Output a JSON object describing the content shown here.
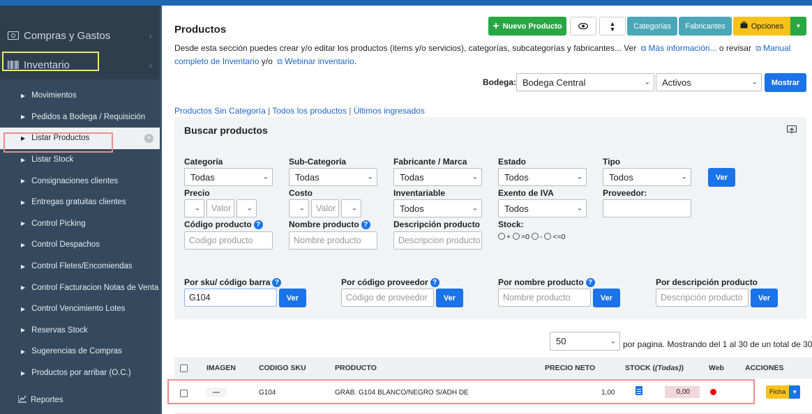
{
  "sidebar": {
    "sections": [
      {
        "label": "Compras y Gastos",
        "icon": "money-icon"
      },
      {
        "label": "Inventario",
        "icon": "barcode-icon"
      }
    ],
    "items": [
      {
        "label": "Movimientos"
      },
      {
        "label": "Pedidos a Bodega / Requisición"
      },
      {
        "label": "Listar Productos"
      },
      {
        "label": "Listar Stock"
      },
      {
        "label": "Consignaciones clientes"
      },
      {
        "label": "Entregas gratuitas clientes"
      },
      {
        "label": "Control Picking"
      },
      {
        "label": "Control Despachos"
      },
      {
        "label": "Control Fletes/Encomiendas"
      },
      {
        "label": "Control Facturacion Notas de Venta"
      },
      {
        "label": "Control Vencimiento Lotes"
      },
      {
        "label": "Reservas Stock"
      },
      {
        "label": "Sugerencias de Compras"
      },
      {
        "label": "Productos por arribar (O.C.)"
      }
    ],
    "reportes": "Reportes"
  },
  "header": {
    "title": "Productos",
    "nuevo_producto": "Nuevo Producto",
    "categorias": "Categorías",
    "fabricantes": "Fabricantes",
    "opciones": "Opciones"
  },
  "description": {
    "text1": "Desde esta sección puedes crear y/o editar los productos (items y/o servicios), categorías, subcategorías y fabricantes... Ver",
    "link1": "Más información...",
    "text2": "o revisar",
    "link2": "Manual completo de Inventario",
    "text3": "y/o",
    "link3": "Webinar inventario",
    "text4": "."
  },
  "filters_top": {
    "bodega_label": "Bodega:",
    "bodega_value": "Bodega Central",
    "estado_value": "Activos",
    "mostrar": "Mostrar"
  },
  "quick_links": [
    "Productos Sin Categoría",
    "Todos los productos",
    "Últimos ingresados"
  ],
  "search": {
    "title": "Buscar productos",
    "categoria_label": "Categoría",
    "categoria_value": "Todas",
    "subcategoria_label": "Sub-Categoría",
    "subcategoria_value": "Todas",
    "fabricante_label": "Fabricante / Marca",
    "fabricante_value": "Todas",
    "estado_label": "Estado",
    "estado_value": "Todos",
    "tipo_label": "Tipo",
    "tipo_value": "Todos",
    "ver": "Ver",
    "precio_label": "Precio",
    "precio_placeholder": "Valor",
    "costo_label": "Costo",
    "costo_placeholder": "Valor",
    "inventariable_label": "Inventariable",
    "inventariable_value": "Todos",
    "exento_label": "Exento de IVA",
    "exento_value": "Todos",
    "proveedor_label": "Proveedor:",
    "codigo_label": "Código producto",
    "codigo_placeholder": "Codigo producto",
    "nombre_label": "Nombre producto",
    "nombre_placeholder": "Nombre producto",
    "descripcion_label": "Descripción producto",
    "descripcion_placeholder": "Descripcion producto",
    "stock_label": "Stock:",
    "stock_options": [
      "+",
      "=0",
      "-",
      "<=0"
    ],
    "sku_label": "Por sku/ código barra",
    "sku_value": "G104",
    "codprov_label": "Por código proveedor",
    "codprov_placeholder": "Código de proveedor",
    "nomprod_label": "Por nombre producto",
    "nomprod_placeholder": "Nombre producto",
    "descprod_label": "Por descripción producto",
    "descprod_placeholder": "Descripción producto"
  },
  "pagination": {
    "per_page": "50",
    "text": "por pagina. Mostrando del 1 al 30 de un total de 30"
  },
  "table": {
    "headers": [
      "IMAGEN",
      "CODIGO SKU",
      "PRODUCTO",
      "PRECIO NETO",
      "STOCK",
      "(Todas)",
      "Web",
      "ACCIONES"
    ],
    "rows": [
      {
        "sku": "G104",
        "producto": "GRAB. G104 BLANCO/NEGRO S/ADH DE",
        "precio": "1,00",
        "stock": "0,00",
        "accion": "Ficha"
      }
    ]
  },
  "colors": {
    "sidebar": "#2f3e4d",
    "primary": "#1a73e8",
    "green": "#28a745",
    "teal": "#4aa7b7",
    "yellow": "#f7c21b",
    "highlight_red": "#ee8b8b",
    "highlight_yellow": "#f0ea6a"
  }
}
